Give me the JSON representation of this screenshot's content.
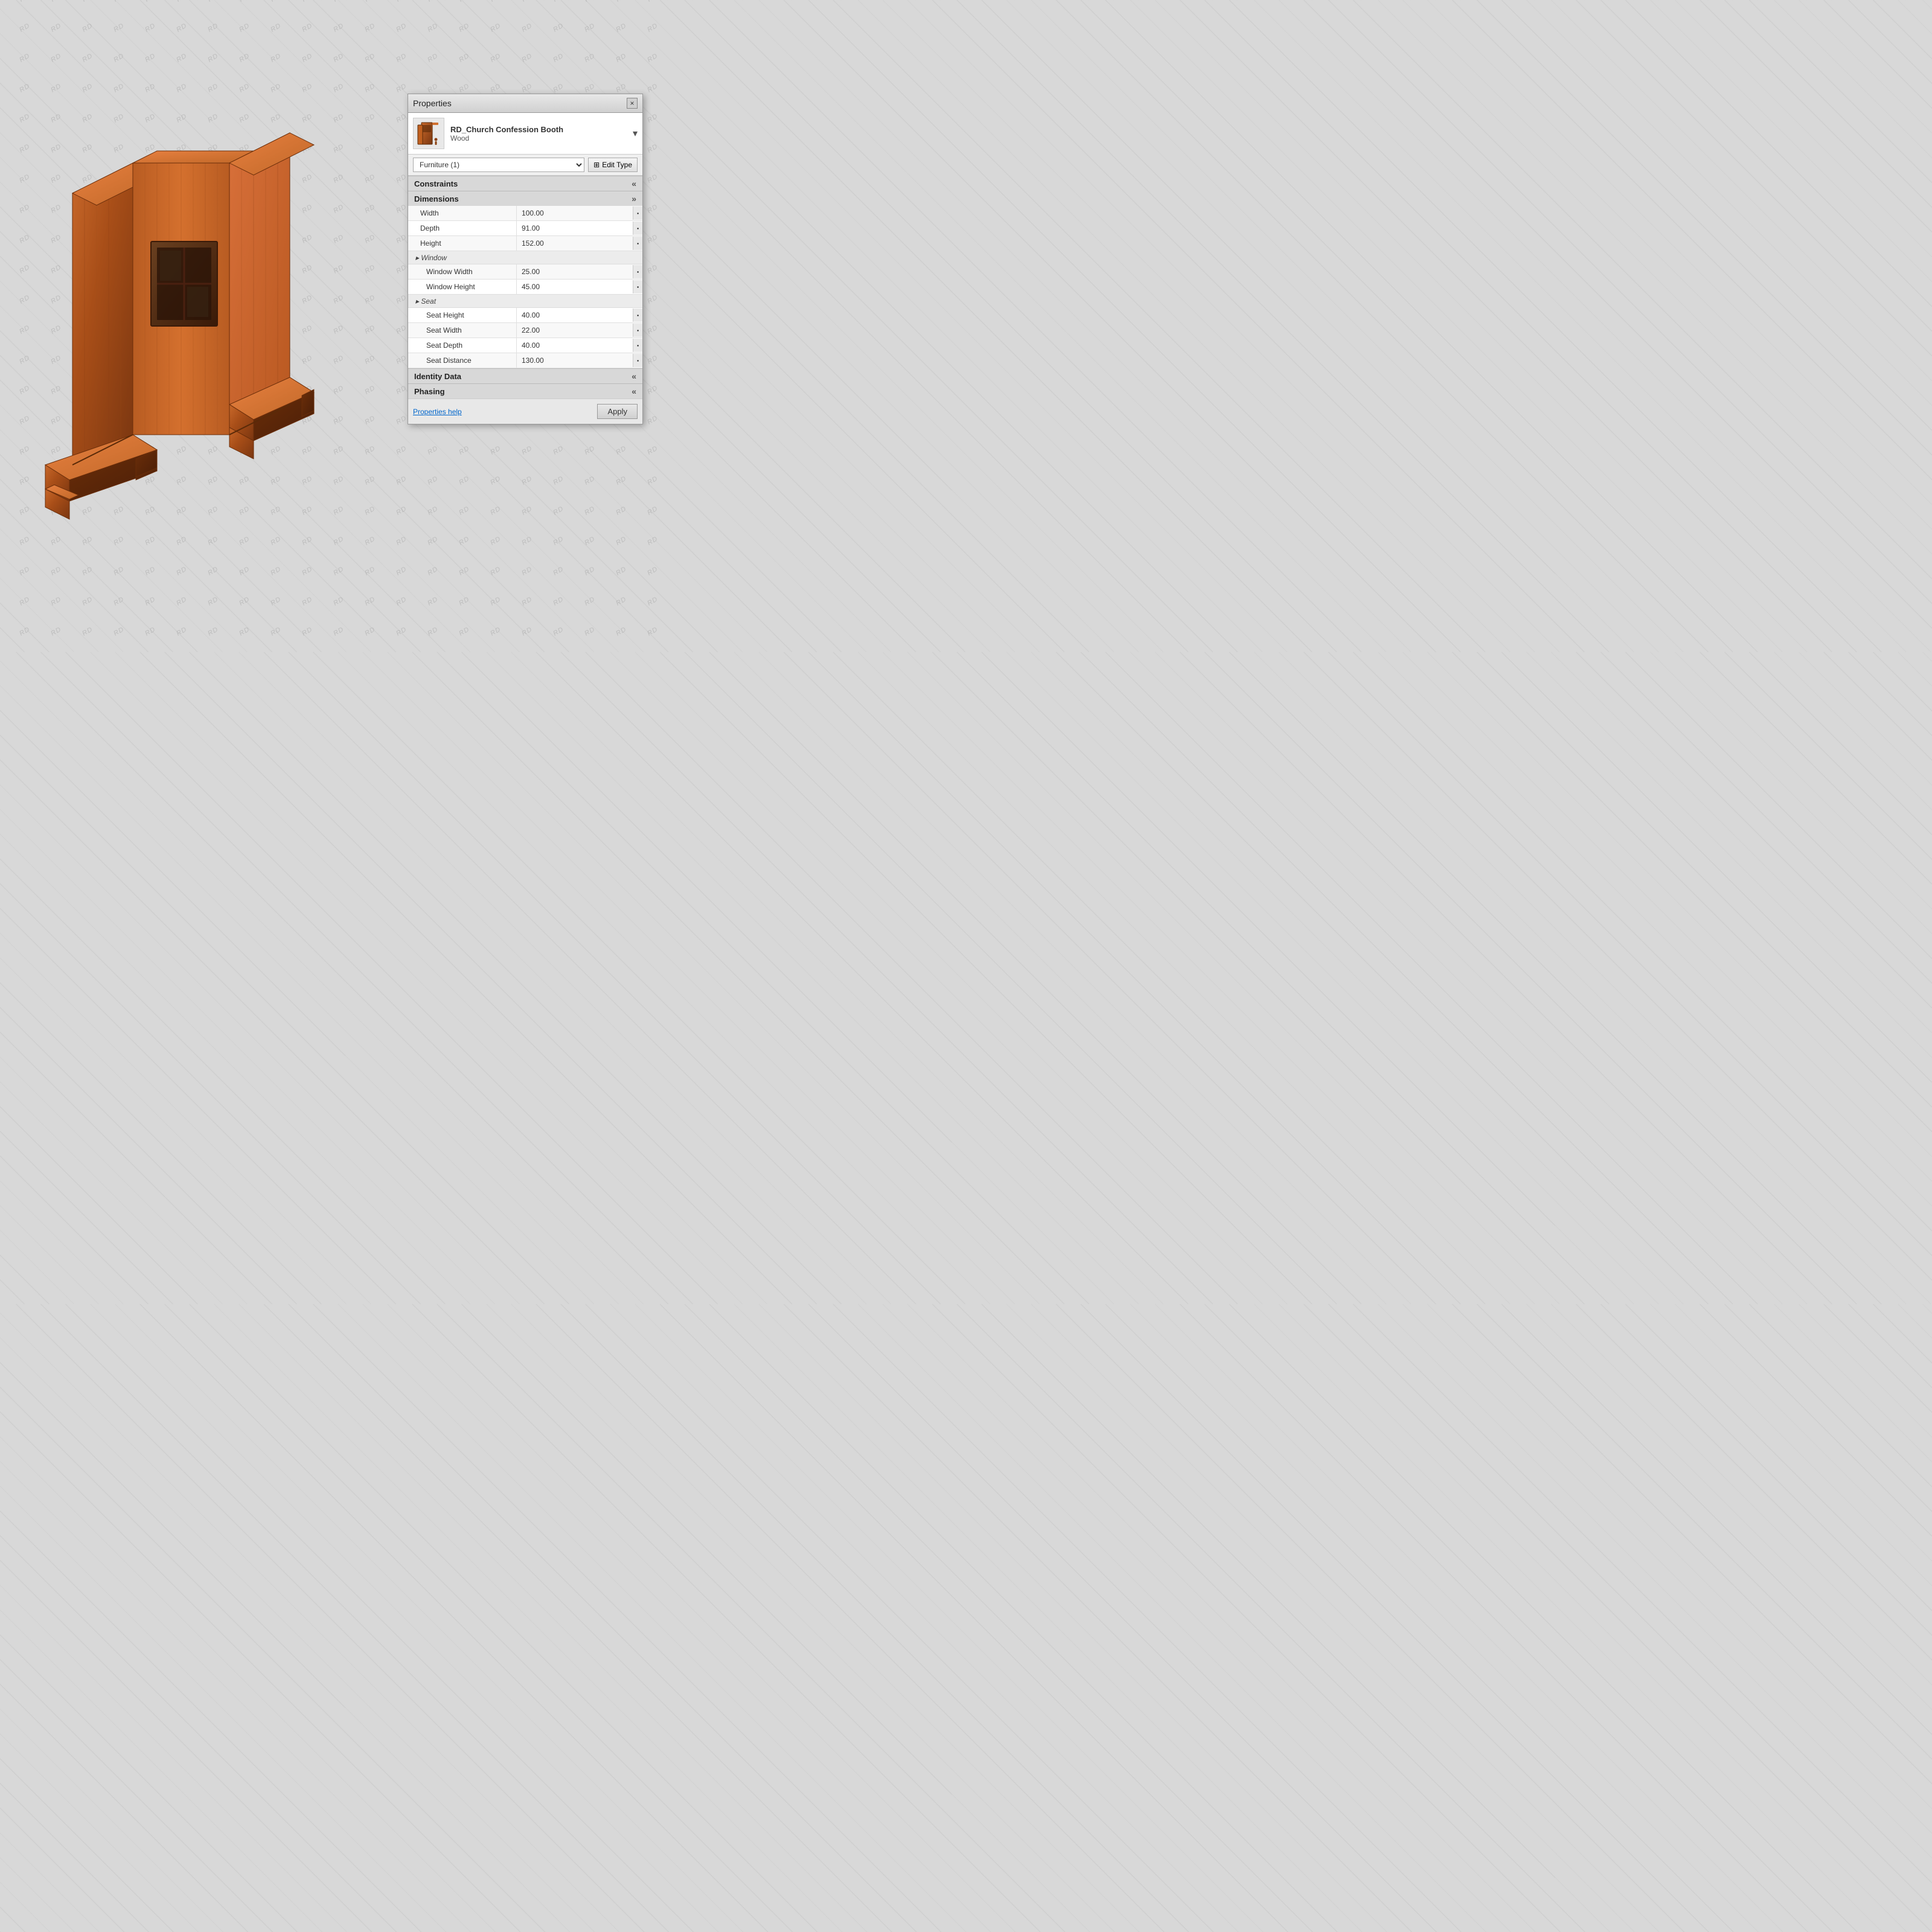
{
  "panel": {
    "title": "Properties",
    "close_label": "×",
    "item": {
      "name_main": "RD_Church Confession Booth",
      "name_sub": "Wood"
    },
    "selector": {
      "current": "Furniture (1)",
      "edit_type_icon": "🖊",
      "edit_type_label": "Edit Type"
    },
    "sections": {
      "constraints": {
        "label": "Constraints",
        "collapsed": true
      },
      "dimensions": {
        "label": "Dimensions",
        "collapsed": false,
        "properties": [
          {
            "label": "Width",
            "value": "100.00"
          },
          {
            "label": "Depth",
            "value": "91.00"
          },
          {
            "label": "Height",
            "value": "152.00"
          }
        ],
        "window_subsection": "Window",
        "window_properties": [
          {
            "label": "Window Width",
            "value": "25.00"
          },
          {
            "label": "Window Height",
            "value": "45.00"
          }
        ],
        "seat_subsection": "Seat",
        "seat_properties": [
          {
            "label": "Seat Height",
            "value": "40.00"
          },
          {
            "label": "Seat Width",
            "value": "22.00"
          },
          {
            "label": "Seat Depth",
            "value": "40.00"
          },
          {
            "label": "Seat Distance",
            "value": "130.00"
          }
        ]
      },
      "identity_data": {
        "label": "Identity Data",
        "collapsed": true
      },
      "phasing": {
        "label": "Phasing",
        "collapsed": true
      }
    },
    "footer": {
      "help_label": "Properties help",
      "apply_label": "Apply"
    }
  },
  "watermark": {
    "text": "RD"
  }
}
